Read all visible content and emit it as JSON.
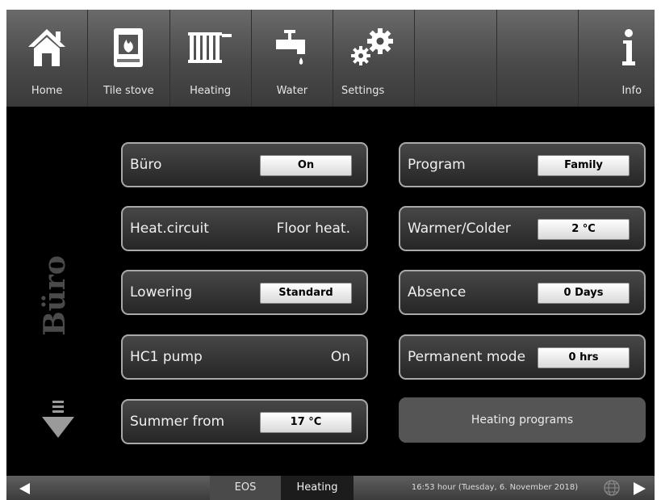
{
  "nav": [
    {
      "label": "Home",
      "icon": "home-icon"
    },
    {
      "label": "Tile stove",
      "icon": "tile-stove-icon"
    },
    {
      "label": "Heating",
      "icon": "radiator-icon"
    },
    {
      "label": "Water",
      "icon": "water-tap-icon"
    },
    {
      "label": "Settings",
      "icon": "gears-icon"
    },
    {
      "label": "",
      "icon": ""
    },
    {
      "label": "",
      "icon": ""
    },
    {
      "label": "Info",
      "icon": "info-icon"
    }
  ],
  "room": {
    "name": "Büro"
  },
  "left_tiles": [
    {
      "label": "Büro",
      "value": "On"
    },
    {
      "label": "Heat.circuit",
      "value": "Floor heat."
    },
    {
      "label": "Lowering",
      "value": "Standard"
    },
    {
      "label": "HC1 pump",
      "value": "On"
    },
    {
      "label": "Summer from",
      "value": "17 °C"
    }
  ],
  "right_tiles": [
    {
      "label": "Program",
      "value": "Family"
    },
    {
      "label": "Warmer/Colder",
      "value": "2 °C"
    },
    {
      "label": "Absence",
      "value": "0 Days"
    },
    {
      "label": "Permanent mode",
      "value": "0 hrs"
    }
  ],
  "programs_button": {
    "label": "Heating programs"
  },
  "status": {
    "eos": "EOS",
    "heating": "Heating",
    "time": "16:53 hour (Tuesday, 6. November 2018)"
  },
  "colors": {
    "background": "#000000",
    "tile_border": "#a9a9a9",
    "value_box": "#ffffff",
    "room_text": "#4a4a4a"
  }
}
